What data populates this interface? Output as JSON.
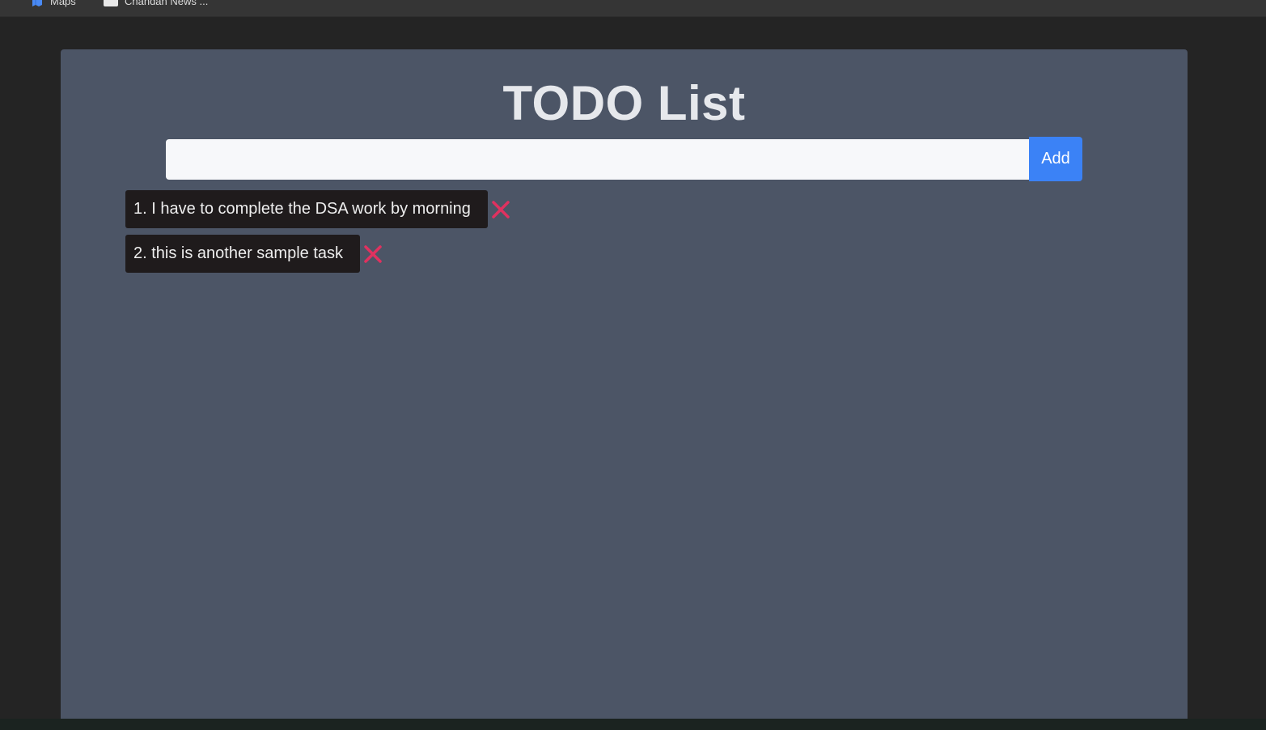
{
  "bookmarks": [
    {
      "label": "Maps",
      "icon": "maps-icon"
    },
    {
      "label": "Chandan News ...",
      "icon": "news-icon"
    }
  ],
  "app": {
    "title": "TODO List",
    "input": {
      "value": "",
      "placeholder": ""
    },
    "add_label": "Add",
    "todos": [
      {
        "text": "1. I have to complete the DSA work by morning"
      },
      {
        "text": "2. this is another sample task"
      }
    ]
  },
  "colors": {
    "panel": "#4c5566",
    "accent": "#3b82f6",
    "todo_bg": "#1f1b1c",
    "delete": "#e0315f",
    "page_bg": "#242424"
  }
}
